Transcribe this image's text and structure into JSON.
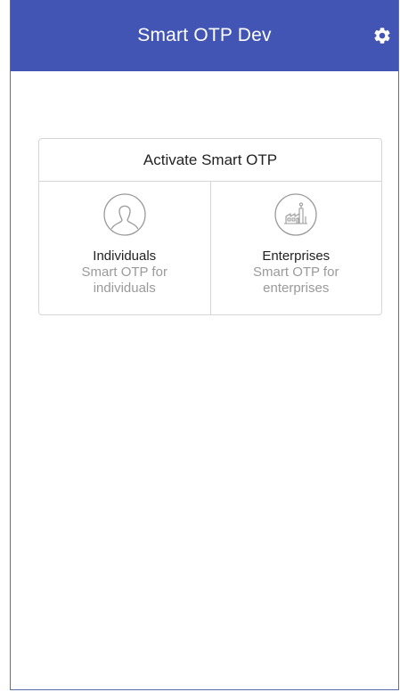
{
  "app_bar": {
    "title": "Smart OTP Dev",
    "settings_icon": "gear-icon",
    "background": "#4255b4"
  },
  "activate_card": {
    "title": "Activate Smart OTP",
    "options": [
      {
        "icon": "person-icon",
        "title": "Individuals",
        "subtitle": "Smart OTP for individuals"
      },
      {
        "icon": "factory-icon",
        "title": "Enterprises",
        "subtitle": "Smart OTP for enterprises"
      }
    ]
  }
}
